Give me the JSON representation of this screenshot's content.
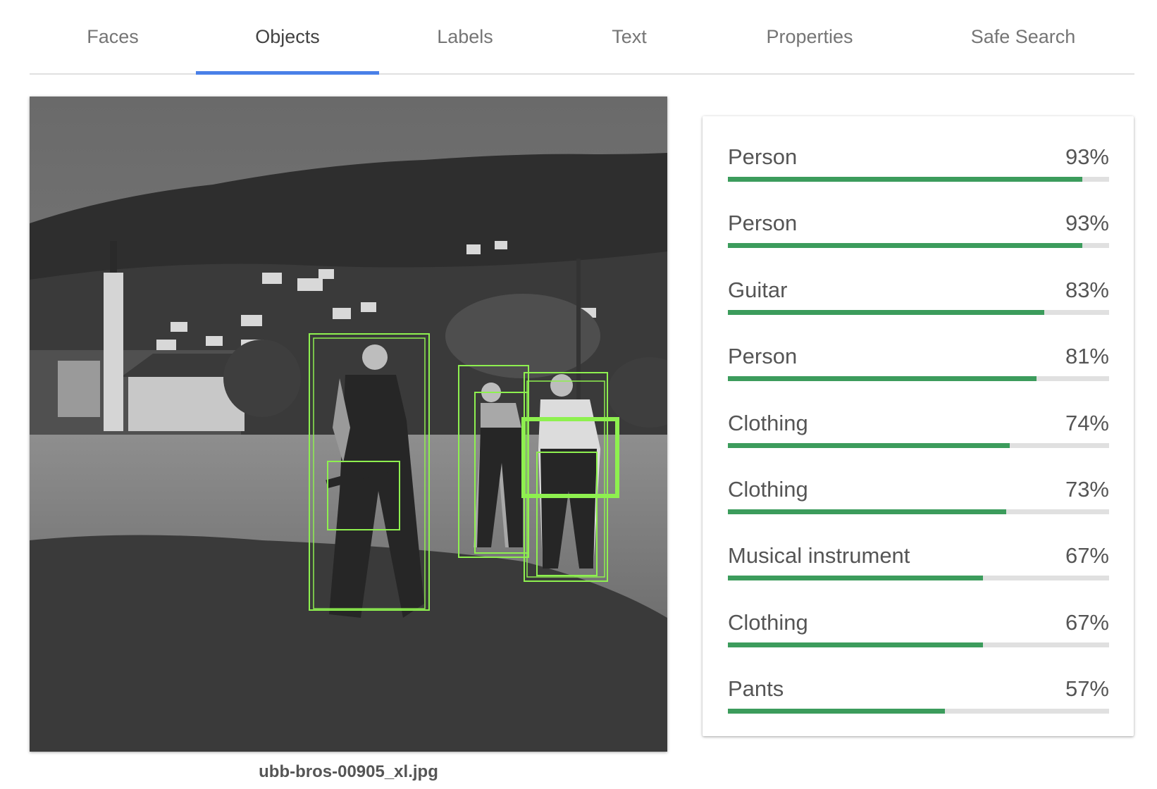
{
  "tabs": [
    {
      "label": "Faces",
      "active": false
    },
    {
      "label": "Objects",
      "active": true
    },
    {
      "label": "Labels",
      "active": false
    },
    {
      "label": "Text",
      "active": false
    },
    {
      "label": "Properties",
      "active": false
    },
    {
      "label": "Safe Search",
      "active": false
    }
  ],
  "image": {
    "filename": "ubb-bros-00905_xl.jpg",
    "box_color": "#8ef04f"
  },
  "results": [
    {
      "label": "Person",
      "score": "93%",
      "value": 0.93
    },
    {
      "label": "Person",
      "score": "93%",
      "value": 0.93
    },
    {
      "label": "Guitar",
      "score": "83%",
      "value": 0.83
    },
    {
      "label": "Person",
      "score": "81%",
      "value": 0.81
    },
    {
      "label": "Clothing",
      "score": "74%",
      "value": 0.74
    },
    {
      "label": "Clothing",
      "score": "73%",
      "value": 0.73
    },
    {
      "label": "Musical instrument",
      "score": "67%",
      "value": 0.67
    },
    {
      "label": "Clothing",
      "score": "67%",
      "value": 0.67
    },
    {
      "label": "Pants",
      "score": "57%",
      "value": 0.57
    }
  ],
  "colors": {
    "tab_indicator": "#4a80e8",
    "bar_fill": "#3c9c5c",
    "bar_track": "#e0e0e0"
  }
}
